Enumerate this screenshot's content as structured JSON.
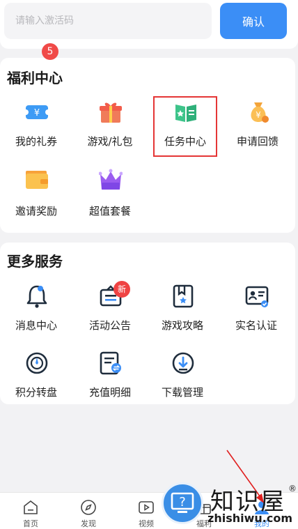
{
  "redeem": {
    "placeholder": "请输入激活码",
    "confirm_label": "确认"
  },
  "welfare": {
    "title": "福利中心",
    "items": [
      {
        "label": "我的礼券",
        "icon": "coupon-icon",
        "badge": "5"
      },
      {
        "label": "游戏/礼包",
        "icon": "gift-icon"
      },
      {
        "label": "任务中心",
        "icon": "task-book-icon"
      },
      {
        "label": "申请回馈",
        "icon": "money-bag-icon"
      },
      {
        "label": "邀请奖励",
        "icon": "wallet-icon"
      },
      {
        "label": "超值套餐",
        "icon": "crown-package-icon"
      }
    ]
  },
  "services": {
    "title": "更多服务",
    "items": [
      {
        "label": "消息中心",
        "icon": "bell-icon"
      },
      {
        "label": "活动公告",
        "icon": "announcement-icon",
        "badge": "新"
      },
      {
        "label": "游戏攻略",
        "icon": "guide-bookmark-icon"
      },
      {
        "label": "实名认证",
        "icon": "id-card-icon"
      },
      {
        "label": "积分转盘",
        "icon": "wheel-icon"
      },
      {
        "label": "充值明细",
        "icon": "recharge-detail-icon"
      },
      {
        "label": "下载管理",
        "icon": "download-icon"
      }
    ]
  },
  "tabbar": {
    "items": [
      {
        "label": "首页",
        "icon": "home-icon"
      },
      {
        "label": "发现",
        "icon": "compass-icon"
      },
      {
        "label": "视频",
        "icon": "video-icon"
      },
      {
        "label": "福利",
        "icon": "welfare-icon"
      },
      {
        "label": "我的",
        "icon": "profile-icon",
        "active": true
      }
    ]
  },
  "watermark": {
    "brand": "知识屋",
    "url": "zhishiwu.com",
    "mark": "®"
  },
  "colors": {
    "accent": "#3b8ef6",
    "badge": "#f04a48",
    "highlight": "#e53535",
    "annotation_arrow": "#e02020"
  }
}
